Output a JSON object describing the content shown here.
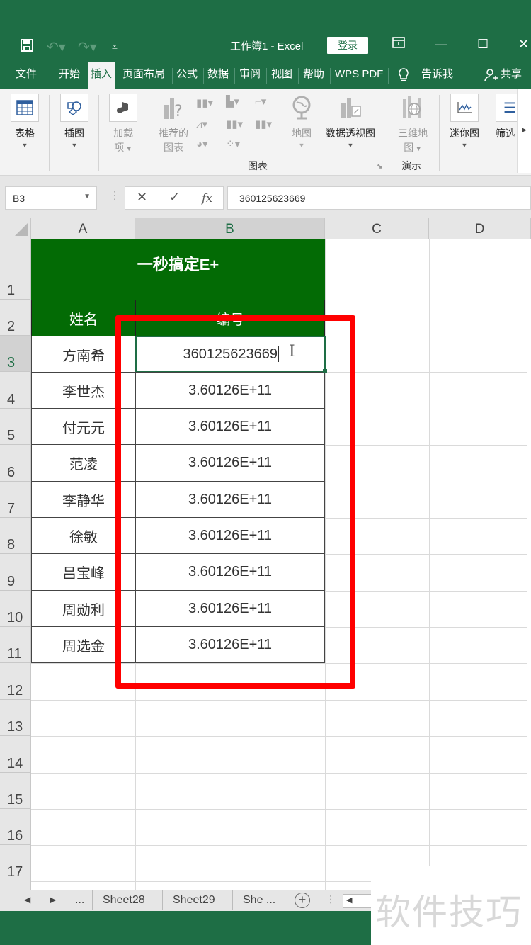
{
  "titlebar": {
    "doc_title": "工作簿1  -  Excel",
    "login_label": "登录",
    "icons": [
      "save-icon",
      "undo-icon",
      "redo-icon",
      "customize-qat-icon",
      "ribbon-display-icon",
      "minimize-icon",
      "maximize-icon",
      "close-icon"
    ]
  },
  "tabs": [
    {
      "label": "文件"
    },
    {
      "label": "开始"
    },
    {
      "label": "插入",
      "active": true
    },
    {
      "label": "页面布局"
    },
    {
      "label": "公式"
    },
    {
      "label": "数据"
    },
    {
      "label": "审阅"
    },
    {
      "label": "视图"
    },
    {
      "label": "帮助"
    },
    {
      "label": "WPS PDF"
    },
    {
      "label": "告诉我"
    },
    {
      "label": "共享"
    }
  ],
  "ribbon": {
    "table": "表格",
    "illustrations": "插图",
    "addins_line1": "加载",
    "addins_line2": "项",
    "recommended_line1": "推荐的",
    "recommended_line2": "图表",
    "maps": "地图",
    "pivotchart": "数据透视图",
    "map3d_line1": "三维地",
    "map3d_line2": "图",
    "sparklines": "迷你图",
    "filters": "筛选",
    "group_charts": "图表",
    "group_tours": "演示"
  },
  "formula_bar": {
    "name_box": "B3",
    "cancel": "✕",
    "enter": "✓",
    "fx": "fx",
    "value": "360125623669"
  },
  "grid": {
    "columns": [
      "A",
      "B",
      "C",
      "D"
    ],
    "selected_column": "B",
    "rows": [
      "1",
      "2",
      "3",
      "4",
      "5",
      "6",
      "7",
      "8",
      "9",
      "10",
      "11",
      "12",
      "13",
      "14",
      "15",
      "16",
      "17"
    ],
    "selected_row": "3",
    "title": "一秒搞定E+",
    "header_name": "姓名",
    "header_id": "编号",
    "records": [
      {
        "name": "方南希",
        "id": "360125623669"
      },
      {
        "name": "李世杰",
        "id": "3.60126E+11"
      },
      {
        "name": "付元元",
        "id": "3.60126E+11"
      },
      {
        "name": "范凌",
        "id": "3.60126E+11"
      },
      {
        "name": "李静华",
        "id": "3.60126E+11"
      },
      {
        "name": "徐敏",
        "id": "3.60126E+11"
      },
      {
        "name": "吕宝峰",
        "id": "3.60126E+11"
      },
      {
        "name": "周勋利",
        "id": "3.60126E+11"
      },
      {
        "name": "周选金",
        "id": "3.60126E+11"
      }
    ],
    "highlight_color": "#ff0000"
  },
  "sheets": {
    "ellipsis": "...",
    "tabs": [
      "Sheet28",
      "Sheet29",
      "She ..."
    ],
    "add": "+"
  },
  "watermark": "软件技巧",
  "colors": {
    "excel_green": "#1e6e45",
    "table_header_green": "#036b05"
  }
}
